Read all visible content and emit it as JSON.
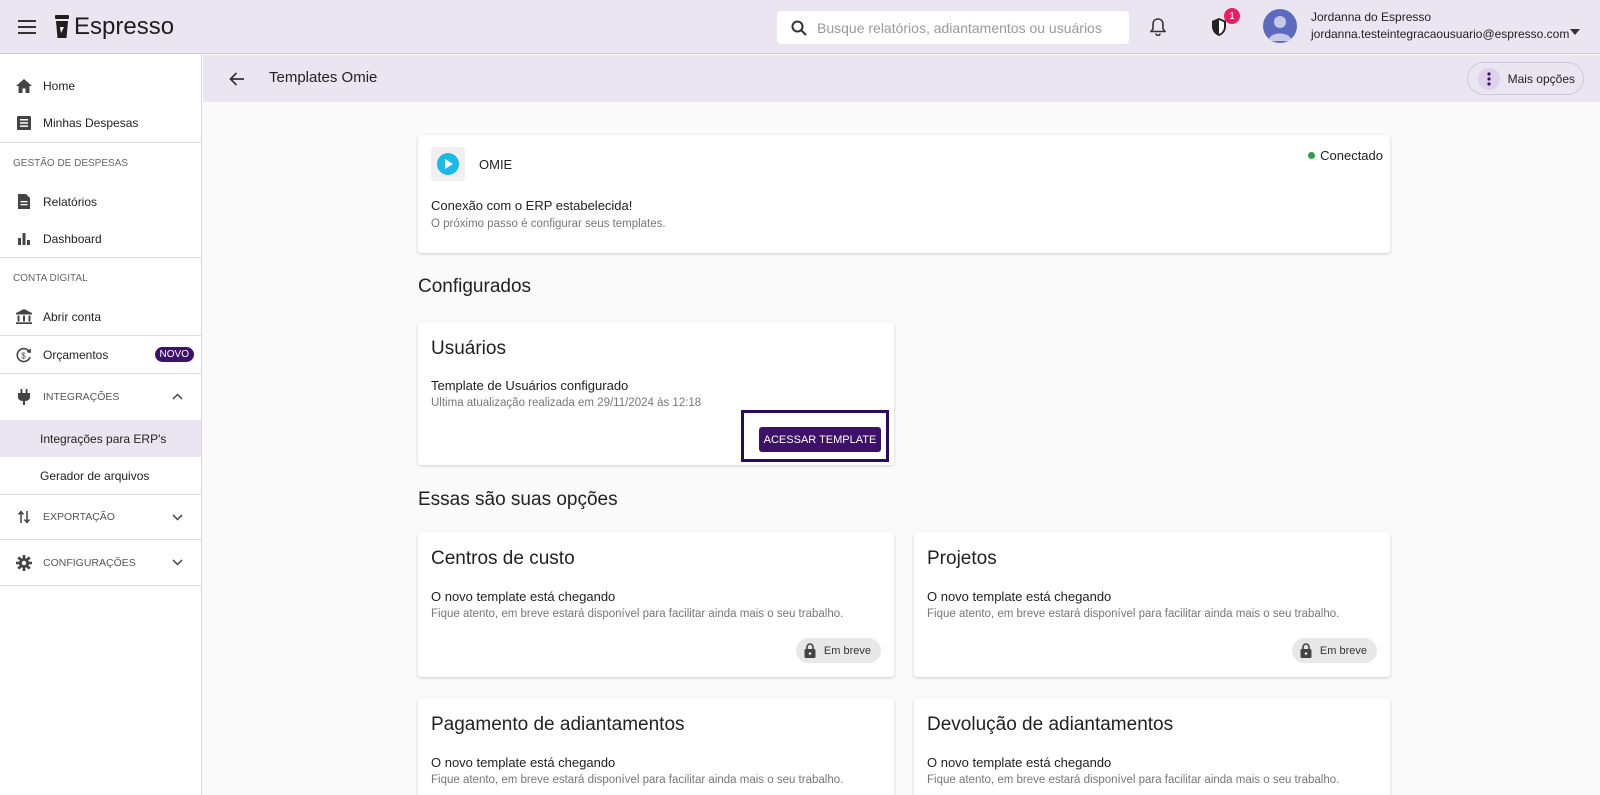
{
  "app": {
    "name": "Espresso"
  },
  "search": {
    "placeholder": "Busque relatórios, adiantamentos ou usuários"
  },
  "notifications": {
    "security_badge": "1"
  },
  "user": {
    "name": "Jordanna do Espresso",
    "email": "jordanna.testeintegracaousuario@espresso.com"
  },
  "sidebar": {
    "home": "Home",
    "minhas_despesas": "Minhas Despesas",
    "gestao_label": "GESTÃO DE DESPESAS",
    "relatorios": "Relatórios",
    "dashboard": "Dashboard",
    "conta_label": "CONTA DIGITAL",
    "abrir_conta": "Abrir conta",
    "orcamentos": "Orçamentos",
    "novo_badge": "NOVO",
    "integracoes": "INTEGRAÇÕES",
    "integracoes_erp": "Integrações para ERP's",
    "gerador": "Gerador de arquivos",
    "exportacao": "EXPORTAÇÃO",
    "configuracoes": "CONFIGURAÇÕES"
  },
  "header": {
    "title": "Templates Omie",
    "more_label": "Mais opções"
  },
  "omie": {
    "name": "OMIE",
    "status": "Conectado",
    "status_color": "#2e9d4c",
    "headline": "Conexão com o ERP estabelecida!",
    "subline": "O próximo passo é configurar seus templates."
  },
  "configured": {
    "section_title": "Configurados",
    "cards": [
      {
        "title": "Usuários",
        "line1": "Template de Usuários configurado",
        "line2": "Ultima atualização realizada em 29/11/2024 às 12:18",
        "button": "ACESSAR TEMPLATE"
      }
    ]
  },
  "options": {
    "section_title": "Essas são suas opções",
    "cards": [
      {
        "title": "Centros de custo",
        "line1": "O novo template está chegando",
        "line2": "Fique atento, em breve estará disponível para facilitar ainda mais o seu trabalho.",
        "chip": "Em breve"
      },
      {
        "title": "Projetos",
        "line1": "O novo template está chegando",
        "line2": "Fique atento, em breve estará disponível para facilitar ainda mais o seu trabalho.",
        "chip": "Em breve"
      },
      {
        "title": "Pagamento de adiantamentos",
        "line1": "O novo template está chegando",
        "line2": "Fique atento, em breve estará disponível para facilitar ainda mais o seu trabalho."
      },
      {
        "title": "Devolução de adiantamentos",
        "line1": "O novo template está chegando",
        "line2": "Fique atento, em breve estará disponível para facilitar ainda mais o seu trabalho."
      }
    ]
  },
  "colors": {
    "primary": "#3e1169",
    "header_bg": "#ebe4f1",
    "badge": "#e91e63"
  }
}
